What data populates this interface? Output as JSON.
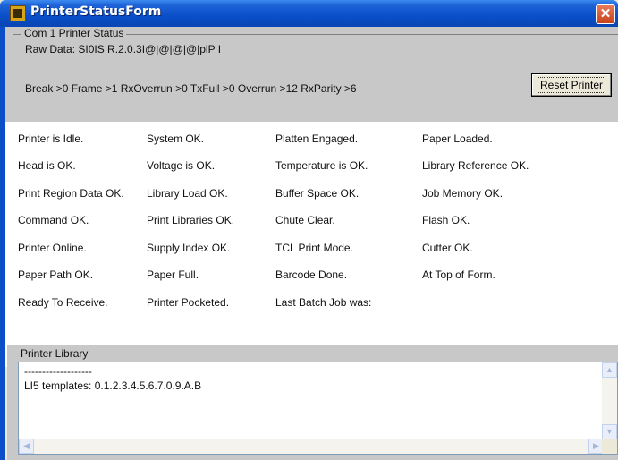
{
  "window": {
    "title": "PrinterStatusForm",
    "close_glyph": "✕"
  },
  "status_group": {
    "caption": "Com 1 Printer Status",
    "raw_data": "Raw Data: SI0IS R.2.0.3I@|@|@|@|plP I",
    "error_counts": "Break >0  Frame >1  RxOverrun >0  TxFull >0  Overrun >12  RxParity >6",
    "reset_label": "Reset Printer"
  },
  "status_grid": [
    [
      "Printer is Idle.",
      "System OK.",
      "Platten Engaged.",
      "Paper Loaded."
    ],
    [
      "Head is OK.",
      "Voltage is OK.",
      "Temperature is OK.",
      "Library Reference OK."
    ],
    [
      "Print Region Data OK.",
      "Library Load OK.",
      "Buffer Space OK.",
      "Job Memory OK."
    ],
    [
      "Command OK.",
      "Print Libraries OK.",
      "Chute Clear.",
      "Flash OK."
    ],
    [
      "Printer Online.",
      "Supply Index OK.",
      "TCL Print Mode.",
      "Cutter OK."
    ],
    [
      "Paper Path OK.",
      "Paper Full.",
      "Barcode Done.",
      "At Top of Form."
    ],
    [
      "Ready To Receive.",
      "Printer Pocketed.",
      "Last Batch Job was:",
      ""
    ]
  ],
  "library": {
    "caption": "Printer Library",
    "line1": "-------------------",
    "line2": "LI5 templates: 0.1.2.3.4.5.6.7.0.9.A.B"
  },
  "icons": {
    "scroll_up": "▲",
    "scroll_down": "▼",
    "scroll_left": "◀",
    "scroll_right": "▶"
  }
}
